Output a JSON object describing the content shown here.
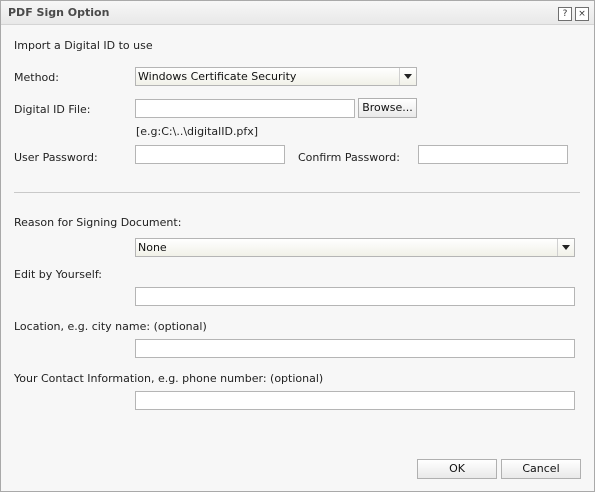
{
  "window": {
    "title": "PDF Sign Option",
    "help_glyph": "?",
    "close_glyph": "×"
  },
  "import_section": {
    "heading": "Import a Digital ID to use",
    "method_label": "Method:",
    "method_value": "Windows Certificate Security",
    "file_label": "Digital ID File:",
    "file_value": "",
    "browse_label": "Browse...",
    "file_hint": "[e.g:C:\\..\\digitalID.pfx]",
    "password_label": "User Password:",
    "password_value": "",
    "confirm_label": "Confirm Password:",
    "confirm_value": ""
  },
  "signing_section": {
    "reason_label": "Reason for Signing Document:",
    "reason_value": "None",
    "edit_label": "Edit by Yourself:",
    "edit_value": "",
    "location_label": "Location, e.g. city name: (optional)",
    "location_value": "",
    "contact_label": "Your Contact Information, e.g. phone number: (optional)",
    "contact_value": ""
  },
  "footer": {
    "ok_label": "OK",
    "cancel_label": "Cancel"
  }
}
